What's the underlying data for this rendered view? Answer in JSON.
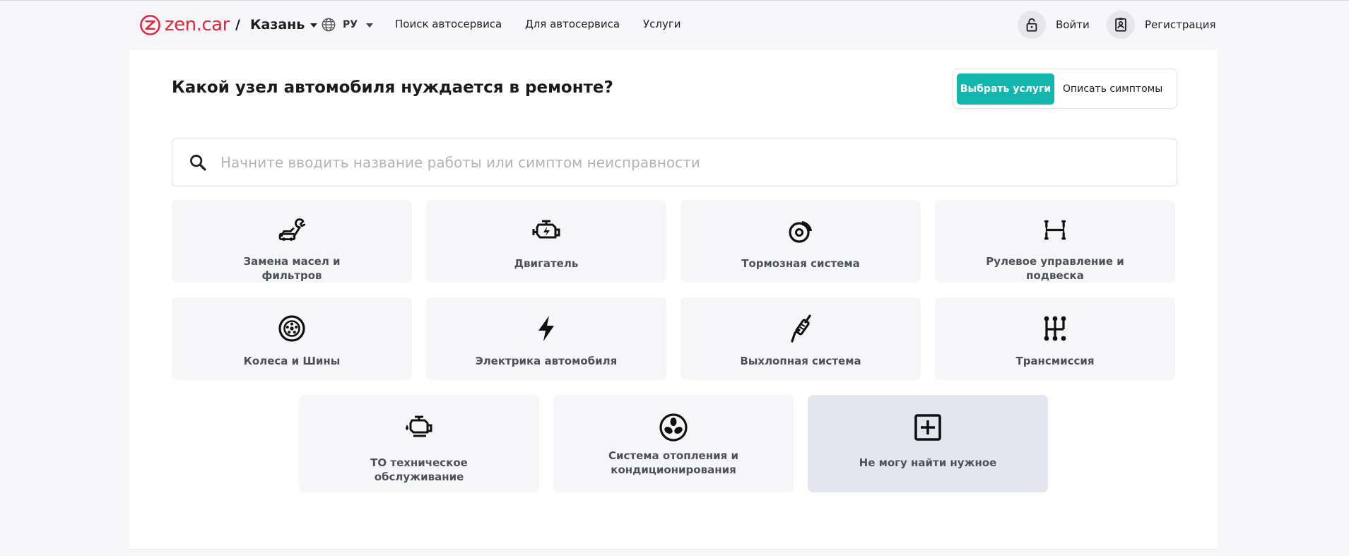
{
  "header": {
    "logo_text": "zen.car",
    "city_separator": "/",
    "city": "Казань",
    "language": "РУ",
    "nav": [
      "Поиск автосервиса",
      "Для автосервиса",
      "Услуги"
    ],
    "login_label": "Войти",
    "register_label": "Регистрация"
  },
  "main": {
    "title": "Какой узел автомобиля нуждается в ремонте?",
    "toggle": {
      "active_label": "Выбрать услуги",
      "inactive_label": "Описать симптомы"
    },
    "search": {
      "placeholder": "Начните вводить название работы или симптом неисправности",
      "value": ""
    },
    "categories": [
      {
        "label": "Замена масел и фильтров",
        "icon": "oil-change-icon"
      },
      {
        "label": "Двигатель",
        "icon": "engine-icon"
      },
      {
        "label": "Тормозная система",
        "icon": "brake-icon"
      },
      {
        "label": "Рулевое управление и подвеска",
        "icon": "suspension-icon"
      },
      {
        "label": "Колеса и Шины",
        "icon": "wheel-icon"
      },
      {
        "label": "Электрика автомобиля",
        "icon": "lightning-icon"
      },
      {
        "label": "Выхлопная система",
        "icon": "exhaust-icon"
      },
      {
        "label": "Трансмиссия",
        "icon": "gearbox-icon"
      },
      {
        "label": "ТО техническое обслуживание",
        "icon": "maintenance-icon"
      },
      {
        "label": "Система отопления и кондиционирования",
        "icon": "fan-icon"
      },
      {
        "label": "Не могу найти нужное",
        "icon": "plus-box-icon"
      }
    ]
  },
  "colors": {
    "brand": "#e4253a",
    "accent": "#14b5ad",
    "tile_bg": "#f6f6f8",
    "tile_highlight_bg": "#e4e6ef"
  }
}
